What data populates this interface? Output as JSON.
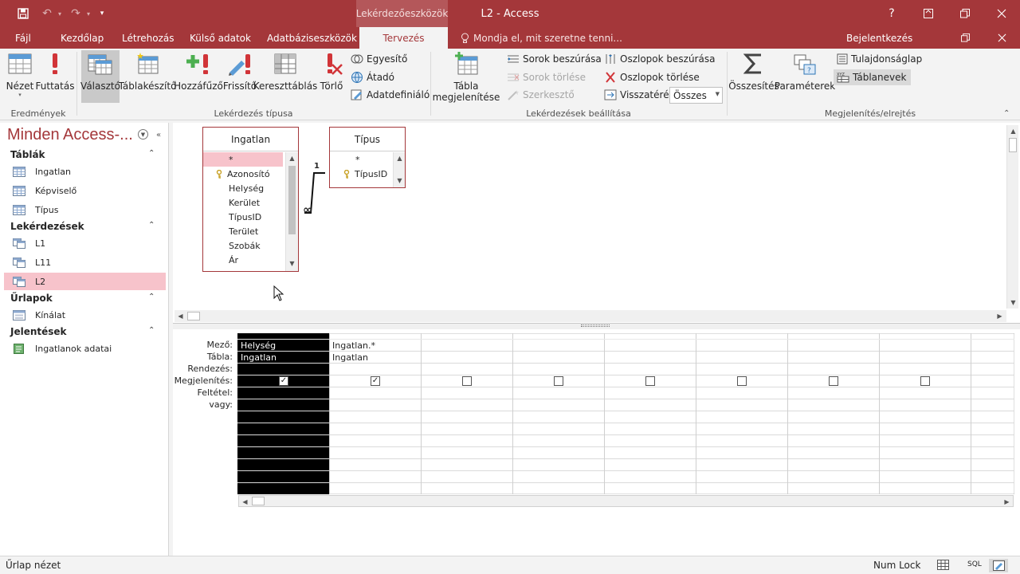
{
  "titlebar": {
    "context_tab": "Lekérdezőeszközök",
    "title": "L2  -  Access",
    "help": "?",
    "accent": "#a4373a"
  },
  "tabs": [
    "Fájl",
    "Kezdőlap",
    "Létrehozás",
    "Külső adatok",
    "Adatbáziseszközök",
    "Tervezés"
  ],
  "active_tab": "Tervezés",
  "tell_me": "Mondja el, mit szeretne tenni...",
  "sign_in": "Bejelentkezés",
  "ribbon": {
    "groups": {
      "results": "Eredmények",
      "query_type": "Lekérdezés típusa",
      "query_setup": "Lekérdezések beállítása",
      "show_hide": "Megjelenítés/elrejtés"
    },
    "buttons": {
      "view": "Nézet",
      "run": "Futtatás",
      "select": "Választó",
      "make_table": "Táblakészítő",
      "append": "Hozzáfűző",
      "update": "Frissítő",
      "crosstab": "Kereszttáblás",
      "delete": "Törlő",
      "union": "Egyesítő",
      "pass_through": "Átadó",
      "data_definition": "Adatdefiniáló",
      "show_table_1": "Tábla",
      "show_table_2": "megjelenítése",
      "insert_rows": "Sorok beszúrása",
      "delete_rows": "Sorok törlése",
      "builder": "Szerkesztő",
      "insert_columns": "Oszlopok beszúrása",
      "delete_columns": "Oszlopok törlése",
      "return_label": "Visszatérés:",
      "return_value": "Összes",
      "totals": "Összesítés",
      "parameters": "Paraméterek",
      "property_sheet": "Tulajdonságlap",
      "table_names": "Táblanevek"
    }
  },
  "nav": {
    "title": "Minden Access-...",
    "groups": [
      {
        "name": "Táblák",
        "items": [
          "Ingatlan",
          "Képviselő",
          "Típus"
        ]
      },
      {
        "name": "Lekérdezések",
        "items": [
          "L1",
          "L11",
          "L2"
        ]
      },
      {
        "name": "Űrlapok",
        "items": [
          "Kínálat"
        ]
      },
      {
        "name": "Jelentések",
        "items": [
          "Ingatlanok adatai"
        ]
      }
    ],
    "selected": "L2"
  },
  "design": {
    "tables": [
      {
        "name": "Ingatlan",
        "fields": [
          "*",
          "Azonosító",
          "Helység",
          "Kerület",
          "TípusID",
          "Terület",
          "Szobák",
          "Ár"
        ]
      },
      {
        "name": "Típus",
        "fields": [
          "*",
          "TípusID"
        ]
      }
    ],
    "join": {
      "one": "1",
      "many": "∞"
    }
  },
  "grid": {
    "row_labels": [
      "Mező:",
      "Tábla:",
      "Rendezés:",
      "Megjelenítés:",
      "Feltétel:",
      "vagy:"
    ],
    "columns": [
      {
        "field": "Helység",
        "table": "Ingatlan",
        "show": true
      },
      {
        "field": "Ingatlan.*",
        "table": "Ingatlan",
        "show": true
      },
      {
        "field": "",
        "table": "",
        "show": false
      },
      {
        "field": "",
        "table": "",
        "show": false
      },
      {
        "field": "",
        "table": "",
        "show": false
      },
      {
        "field": "",
        "table": "",
        "show": false
      },
      {
        "field": "",
        "table": "",
        "show": false
      },
      {
        "field": "",
        "table": "",
        "show": false
      }
    ]
  },
  "status": {
    "left": "Űrlap nézet",
    "numlock": "Num Lock",
    "sql": "SQL"
  }
}
